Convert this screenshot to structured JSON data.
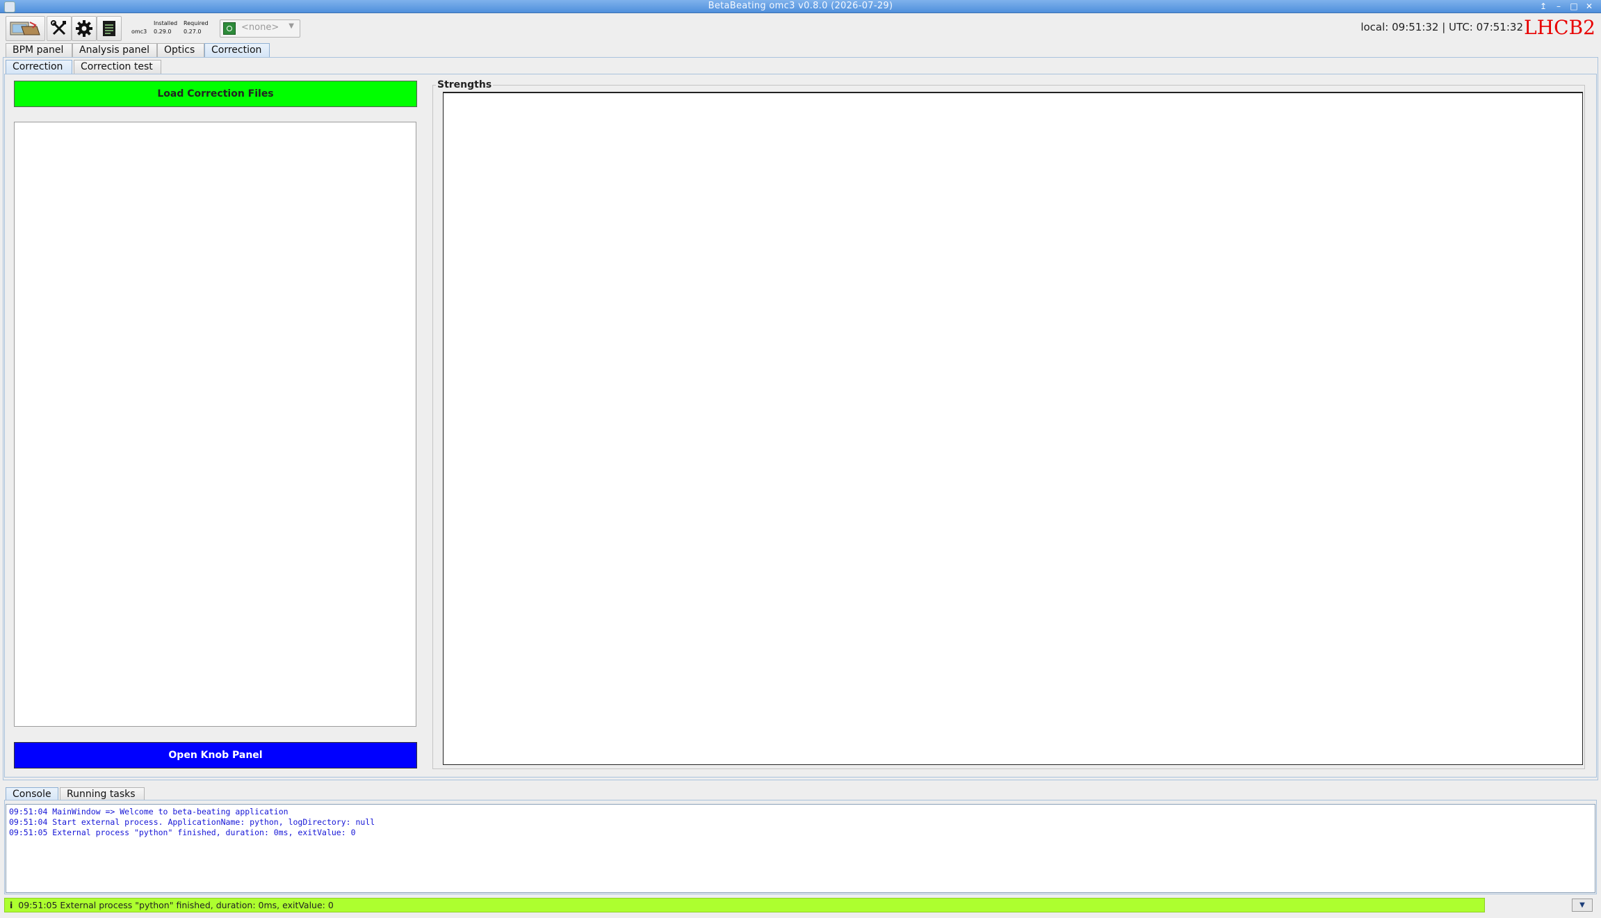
{
  "window": {
    "title": "BetaBeating omc3 v0.8.0 (2026-07-29)"
  },
  "toolbar": {
    "omc3": {
      "name": "omc3",
      "installed_label": "Installed",
      "installed_version": "0.29.0",
      "required_label": "Required",
      "required_version": "0.27.0"
    },
    "beam_select_value": "<none>",
    "clock": "local: 09:51:32 | UTC: 07:51:32",
    "machine": "LHCB2"
  },
  "main_tabs": [
    {
      "label": "BPM panel",
      "selected": false
    },
    {
      "label": "Analysis panel",
      "selected": false
    },
    {
      "label": "Optics",
      "selected": false
    },
    {
      "label": "Correction",
      "selected": true
    }
  ],
  "sub_tabs": [
    {
      "label": "Correction",
      "selected": true
    },
    {
      "label": "Correction test",
      "selected": false
    }
  ],
  "correction": {
    "load_button": "Load Correction Files",
    "knob_button": "Open Knob Panel",
    "strengths_title": "Strengths"
  },
  "bottom_tabs": [
    {
      "label": "Console",
      "selected": true
    },
    {
      "label": "Running tasks",
      "selected": false
    }
  ],
  "console": {
    "lines": [
      "09:51:04 MainWindow => Welcome to beta-beating application",
      "09:51:04 Start external process. ApplicationName: python, logDirectory: null",
      "09:51:05 External process \"python\" finished, duration: 0ms, exitValue: 0"
    ]
  },
  "status": {
    "icon": "info-icon",
    "text": "09:51:05 External process \"python\" finished, duration: 0ms, exitValue: 0"
  },
  "colors": {
    "load_button": "#00ff00",
    "knob_button": "#0000ff",
    "status_bar": "#adff2f",
    "machine_label": "#e80000",
    "console_text": "#1414d6"
  }
}
